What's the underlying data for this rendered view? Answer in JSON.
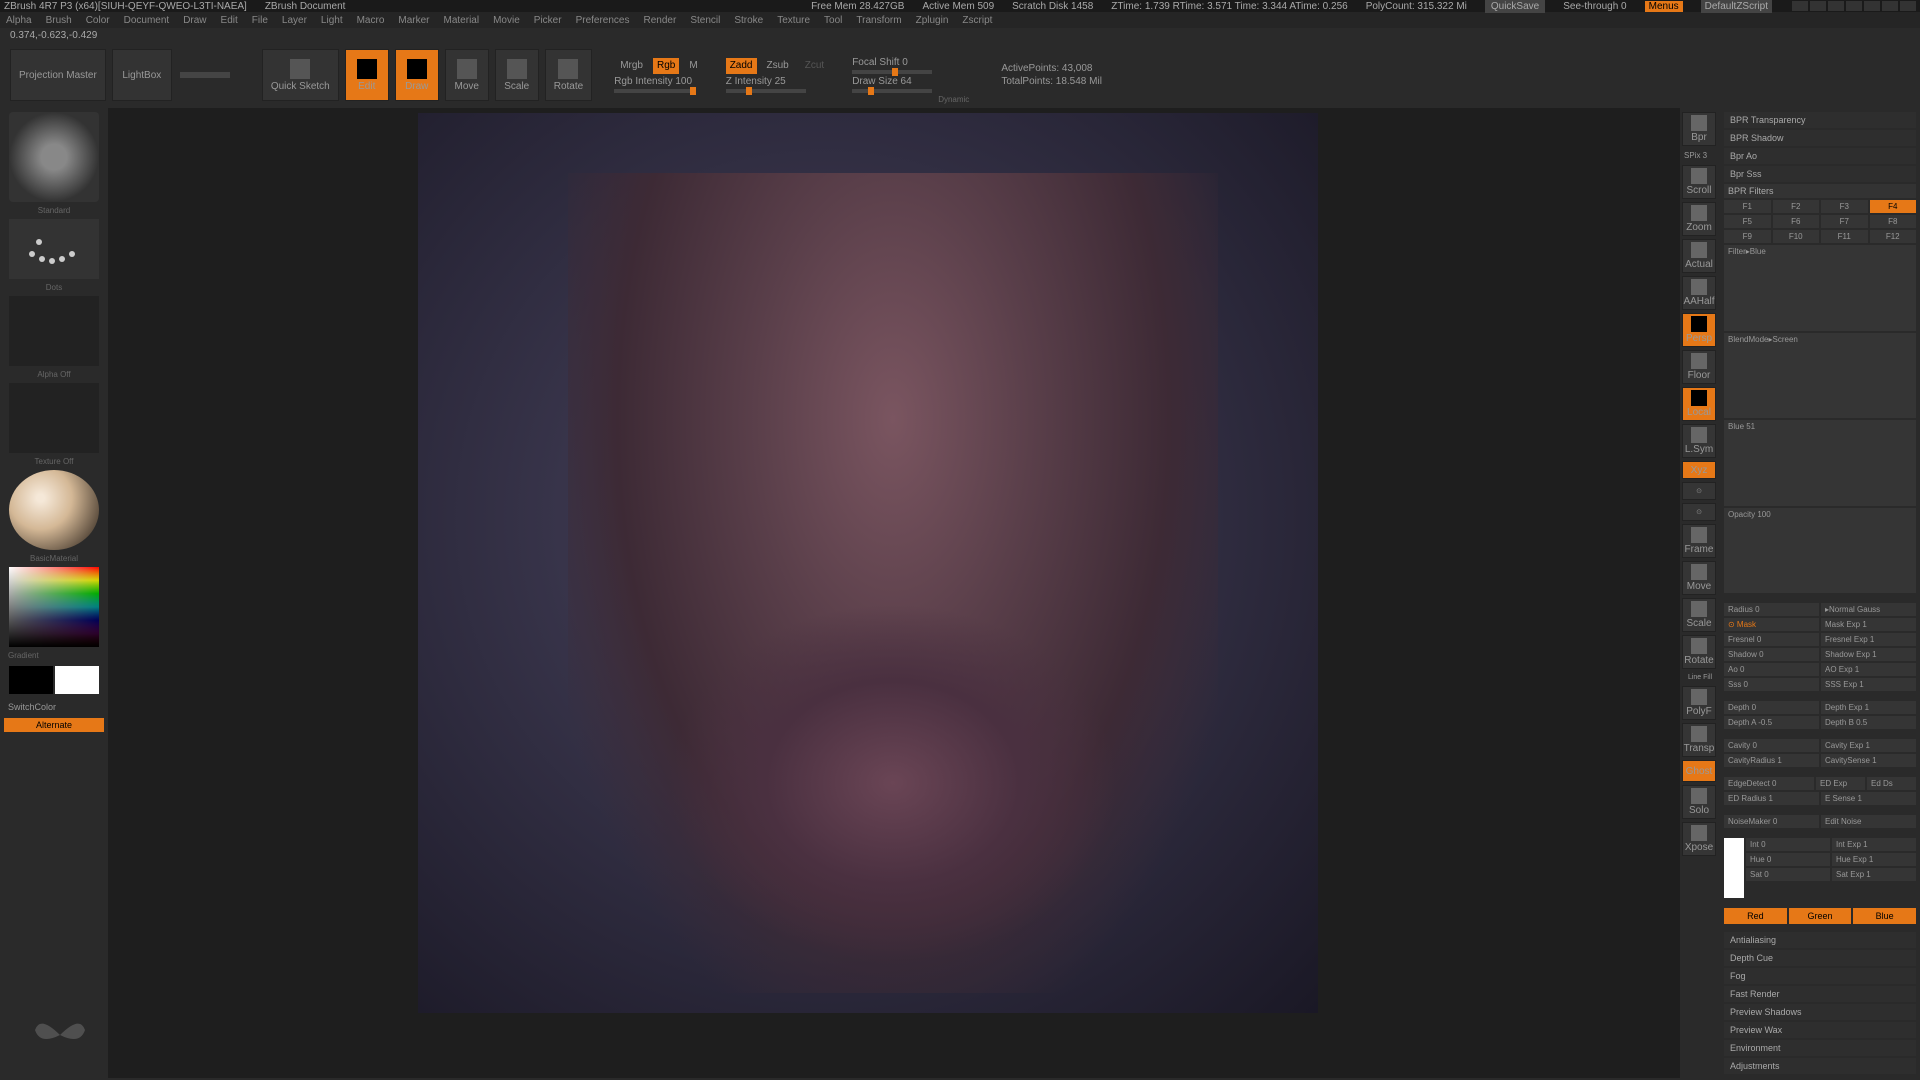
{
  "titlebar": {
    "app": "ZBrush 4R7 P3 (x64)[SIUH-QEYF-QWEO-L3TI-NAEA]",
    "doc": "ZBrush Document",
    "freemem": "Free Mem  28.427GB",
    "activemem": "Active Mem  509",
    "scratch": "Scratch Disk 1458",
    "ztime": "ZTime: 1.739 RTime: 3.571 Time: 3.344 ATime: 0.256",
    "poly": "PolyCount: 315.322 Mi",
    "quicksave": "QuickSave",
    "seethrough": "See-through  0",
    "menus": "Menus",
    "script": "DefaultZScript"
  },
  "menus": [
    "Alpha",
    "Brush",
    "Color",
    "Document",
    "Draw",
    "Edit",
    "File",
    "Layer",
    "Light",
    "Macro",
    "Marker",
    "Material",
    "Movie",
    "Picker",
    "Preferences",
    "Render",
    "Stencil",
    "Stroke",
    "Texture",
    "Tool",
    "Transform",
    "Zplugin",
    "Zscript"
  ],
  "coord": "0.374,-0.623,-0.429",
  "toolbar": {
    "projection": "Projection Master",
    "lightbox": "LightBox",
    "quicksketch": "Quick Sketch",
    "edit": "Edit",
    "draw": "Draw",
    "move": "Move",
    "scale": "Scale",
    "rotate": "Rotate",
    "mrgb": "Mrgb",
    "rgb": "Rgb",
    "m": "M",
    "rgbint": "Rgb Intensity 100",
    "zadd": "Zadd",
    "zsub": "Zsub",
    "zcut": "Zcut",
    "zint": "Z Intensity 25",
    "focal": "Focal Shift 0",
    "drawsize": "Draw Size 64",
    "dynamic": "Dynamic",
    "active": "ActivePoints: 43,008",
    "total": "TotalPoints: 18.548 Mil"
  },
  "left": {
    "brush": "Standard",
    "stroke": "Dots",
    "alpha": "Alpha Off",
    "texture": "Texture Off",
    "material": "BasicMaterial",
    "gradient": "Gradient",
    "switch": "SwitchColor",
    "alternate": "Alternate"
  },
  "nav": [
    "Bpr",
    "Scroll",
    "Zoom",
    "Actual",
    "AAHalf",
    "Persp",
    "Floor",
    "Local",
    "L.Sym",
    "Xyz",
    "Frame",
    "Move",
    "Scale",
    "Rotate",
    "Line Fill",
    "PolyF",
    "Transp",
    "Ghost",
    "Solo",
    "Xpose"
  ],
  "right": {
    "transparency": "BPR Transparency",
    "shadow": "BPR Shadow",
    "ao": "Bpr Ao",
    "sss": "Bpr Sss",
    "filters": "BPR Filters",
    "f": [
      "F1",
      "F2",
      "F3",
      "F4",
      "F5",
      "F6",
      "F7",
      "F8",
      "F9",
      "F10",
      "F11",
      "F12"
    ],
    "filter": "Filter▸Blue",
    "blend": "BlendMode▸Screen",
    "blue": "Blue 51",
    "opacity": "Opacity 100",
    "radius": "Radius 0",
    "normal": "▸Normal Gauss",
    "mask": "⊙ Mask",
    "maskexp": "Mask Exp 1",
    "fresnel": "Fresnel 0",
    "fresnelexp": "Fresnel Exp 1",
    "shadow2": "Shadow 0",
    "shadowexp": "Shadow Exp 1",
    "ao2": "Ao 0",
    "aoexp": "AO Exp 1",
    "sss2": "Sss 0",
    "sssexp": "SSS Exp 1",
    "depth": "Depth 0",
    "depthexp": "Depth Exp 1",
    "deptha": "Depth A -0.5",
    "depthb": "Depth B 0.5",
    "cavity": "Cavity 0",
    "cavityexp": "Cavity Exp 1",
    "cavityrad": "CavityRadius 1",
    "cavitysense": "CavitySense 1",
    "edge": "EdgeDetect 0",
    "edexp": "ED Exp",
    "edds": "Ed Ds",
    "edrad": "ED Radius 1",
    "esense": "E Sense 1",
    "noise": "NoiseMaker 0",
    "editnoise": "Edit Noise",
    "int": "Int 0",
    "intexp": "Int Exp 1",
    "hue": "Hue 0",
    "hueexp": "Hue Exp 1",
    "sat": "Sat 0",
    "satexp": "Sat Exp 1",
    "red": "Red",
    "green": "Green",
    "blueb": "Blue",
    "sections": [
      "Antialiasing",
      "Depth Cue",
      "Fog",
      "Fast Render",
      "Preview Shadows",
      "Preview Wax",
      "Environment",
      "Adjustments"
    ]
  }
}
